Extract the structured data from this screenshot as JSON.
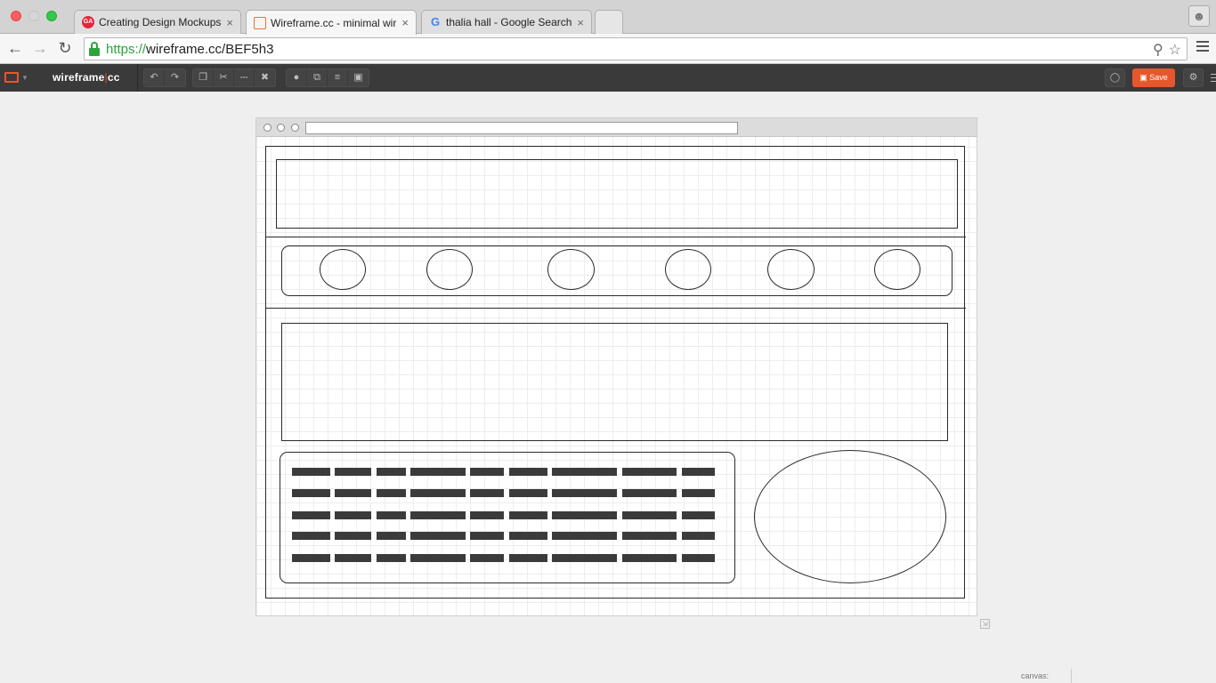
{
  "browser": {
    "tabs": [
      {
        "title": "Creating Design Mockups |",
        "favicon_text": "GA"
      },
      {
        "title": "Wireframe.cc - minimal wir",
        "favicon_text": ""
      },
      {
        "title": "thalia hall - Google Search",
        "favicon_text": "G"
      }
    ],
    "tab_close_glyph": "×",
    "url_scheme": "https://",
    "url_rest": "wireframe.cc/BEF5h3"
  },
  "app": {
    "logo_left": "wireframe",
    "logo_sep": "|",
    "logo_right": "cc",
    "save_label": "Save",
    "status_label": "canvas:"
  },
  "colors": {
    "accent": "#e8562e",
    "secure_green": "#2ca43c",
    "toolbar_dark": "#3a3a3a"
  }
}
